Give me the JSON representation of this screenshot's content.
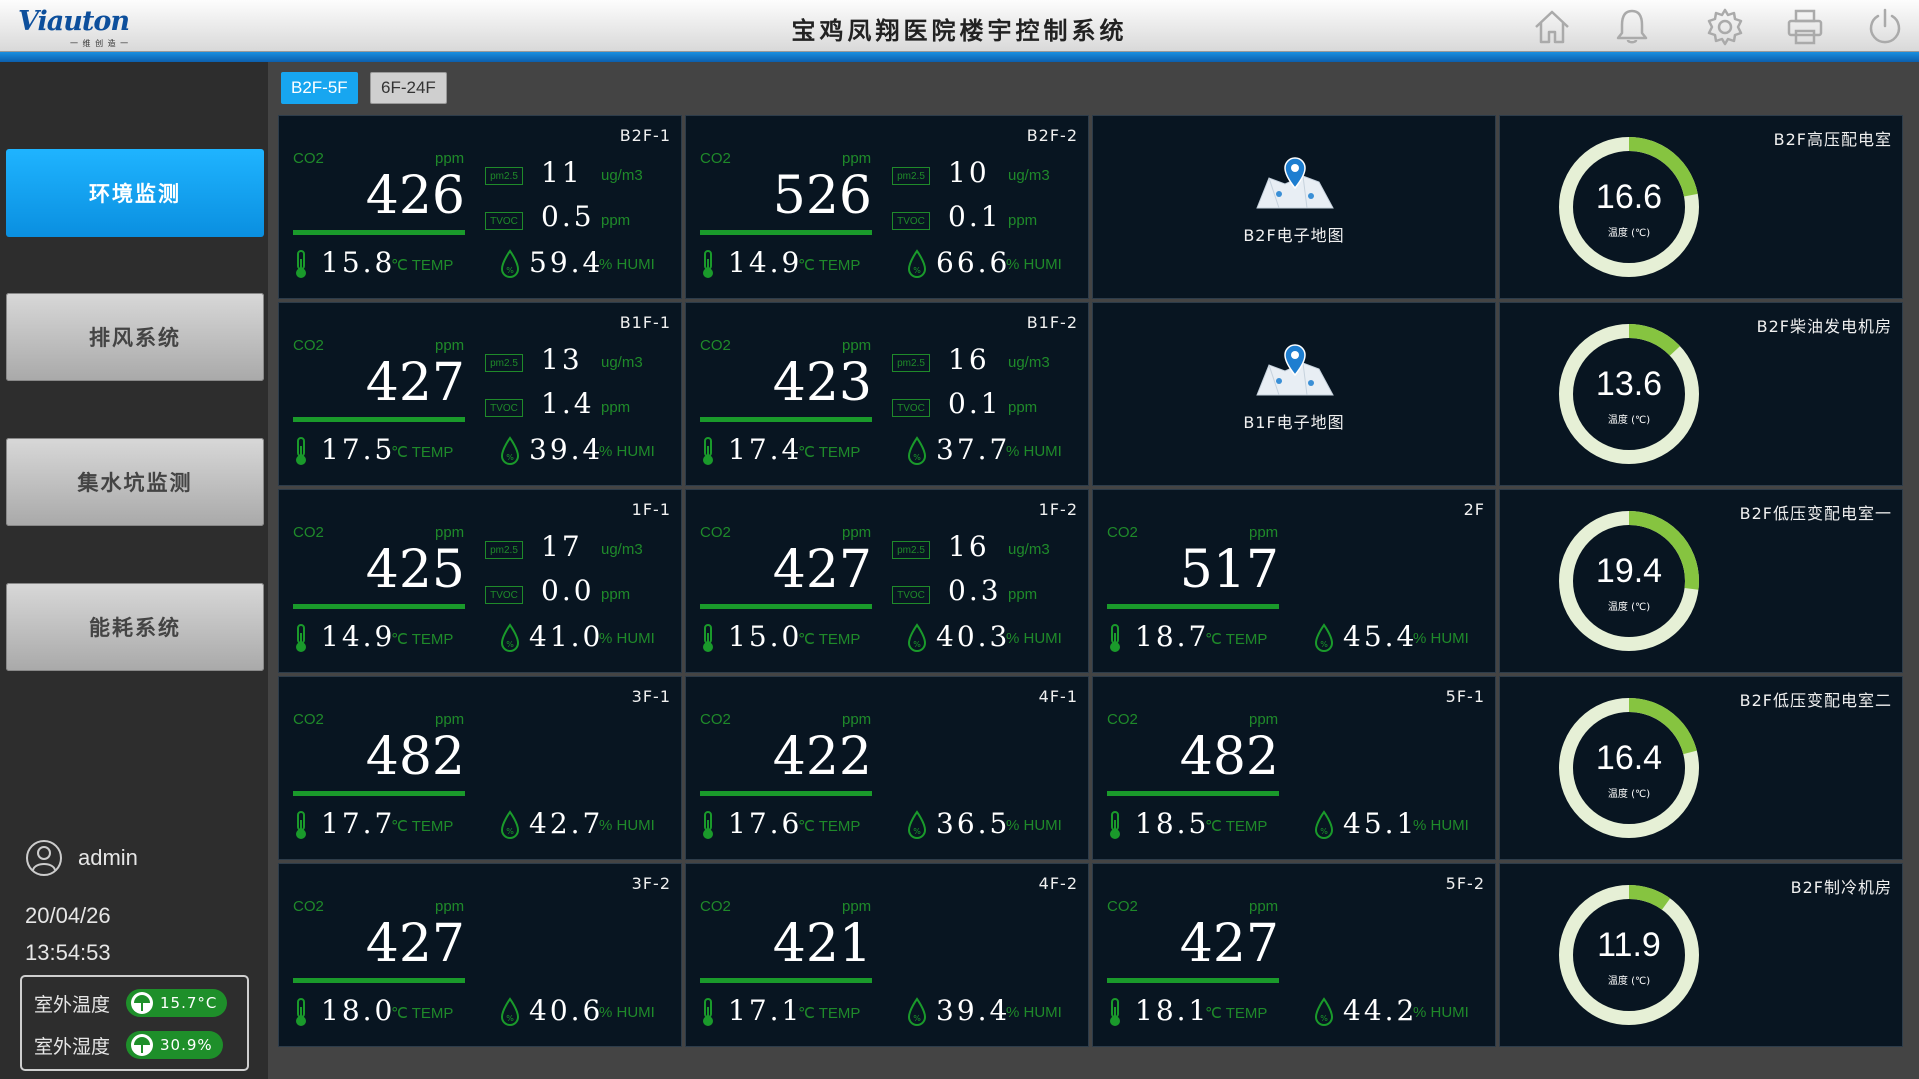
{
  "header": {
    "logo": "Viauton",
    "logo_sub": "一 维 创 造 一",
    "title": "宝鸡凤翔医院楼宇控制系统",
    "icons": [
      "home-icon",
      "bell-icon",
      "gear-icon",
      "printer-icon",
      "power-icon"
    ]
  },
  "sidebar": {
    "nav": [
      {
        "label": "环境监测",
        "active": true
      },
      {
        "label": "排风系统",
        "active": false
      },
      {
        "label": "集水坑监测",
        "active": false
      },
      {
        "label": "能耗系统",
        "active": false
      }
    ],
    "user": "admin",
    "date": "20/04/26",
    "time": "13:54:53",
    "outdoor_temp_label": "室外温度",
    "outdoor_temp_value": "15.7°C",
    "outdoor_humi_label": "室外湿度",
    "outdoor_humi_value": "30.9%"
  },
  "tabs": [
    {
      "label": "B2F-5F",
      "active": true
    },
    {
      "label": "6F-24F",
      "active": false
    }
  ],
  "labels": {
    "co2": "CO2",
    "ppm": "ppm",
    "pm25": "pm2.5",
    "tvoc": "TVOC",
    "ugm3": "ug/m3",
    "temp_unit": "℃ TEMP",
    "humi_unit": "% HUMI",
    "gauge_unit": "温度 (℃)"
  },
  "sensors": [
    {
      "title": "B2F-1",
      "co2": "426",
      "pm25": "11",
      "tvoc": "0.5",
      "temp": "15.8",
      "humi": "59.4"
    },
    {
      "title": "B2F-2",
      "co2": "526",
      "pm25": "10",
      "tvoc": "0.1",
      "temp": "14.9",
      "humi": "66.6"
    },
    {
      "title": "B1F-1",
      "co2": "427",
      "pm25": "13",
      "tvoc": "1.4",
      "temp": "17.5",
      "humi": "39.4"
    },
    {
      "title": "B1F-2",
      "co2": "423",
      "pm25": "16",
      "tvoc": "0.1",
      "temp": "17.4",
      "humi": "37.7"
    },
    {
      "title": "1F-1",
      "co2": "425",
      "pm25": "17",
      "tvoc": "0.0",
      "temp": "14.9",
      "humi": "41.0"
    },
    {
      "title": "1F-2",
      "co2": "427",
      "pm25": "16",
      "tvoc": "0.3",
      "temp": "15.0",
      "humi": "40.3"
    },
    {
      "title": "2F",
      "co2": "517",
      "temp": "18.7",
      "humi": "45.4"
    },
    {
      "title": "3F-1",
      "co2": "482",
      "temp": "17.7",
      "humi": "42.7"
    },
    {
      "title": "4F-1",
      "co2": "422",
      "temp": "17.6",
      "humi": "36.5"
    },
    {
      "title": "5F-1",
      "co2": "482",
      "temp": "18.5",
      "humi": "45.1"
    },
    {
      "title": "3F-2",
      "co2": "427",
      "temp": "18.0",
      "humi": "40.6"
    },
    {
      "title": "4F-2",
      "co2": "421",
      "temp": "17.1",
      "humi": "39.4"
    },
    {
      "title": "5F-2",
      "co2": "427",
      "temp": "18.1",
      "humi": "44.2"
    }
  ],
  "maps": [
    {
      "label": "B2F电子地图"
    },
    {
      "label": "B1F电子地图"
    }
  ],
  "rooms": [
    {
      "title": "B2F高压配电室",
      "value": "16.6",
      "fraction": 0.22
    },
    {
      "title": "B2F柴油发电机房",
      "value": "13.6",
      "fraction": 0.13
    },
    {
      "title": "B2F低压变配电室一",
      "value": "19.4",
      "fraction": 0.27
    },
    {
      "title": "B2F低压变配电室二",
      "value": "16.4",
      "fraction": 0.21
    },
    {
      "title": "B2F制冷机房",
      "value": "11.9",
      "fraction": 0.1
    }
  ],
  "colors": {
    "accent_blue": "#17a6f0",
    "accent_green": "#1a9a2b",
    "gauge_green": "#86c440",
    "gauge_track": "#e6f0d6",
    "panel_bg": "#081521"
  }
}
